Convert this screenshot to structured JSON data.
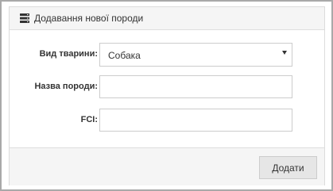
{
  "panel": {
    "title": "Додавання нової породи",
    "icon": "server-stack-icon"
  },
  "form": {
    "animal_type": {
      "label": "Вид тварини:",
      "value": "Собака"
    },
    "breed_name": {
      "label": "Назва породи:",
      "value": ""
    },
    "fci": {
      "label": "FCI:",
      "value": ""
    }
  },
  "footer": {
    "add_label": "Додати"
  }
}
